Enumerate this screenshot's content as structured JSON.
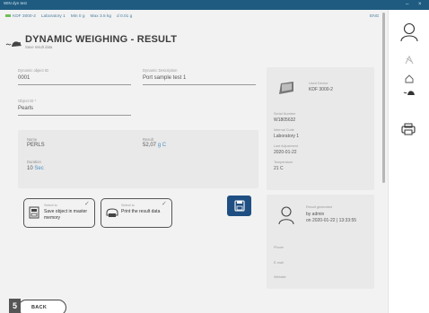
{
  "titlebar": {
    "app": "WIN dyn test",
    "minimize": "–",
    "close": "×"
  },
  "infobar": {
    "device": "KDF 3000-2",
    "lab": "Laboratory 1",
    "min": "Min 0 g",
    "max": "Max 3.5 kg",
    "d": "d 0.01 g",
    "lang": "ENG"
  },
  "header": {
    "title": "DYNAMIC WEIGHING - RESULT",
    "subtitle": "Save result data"
  },
  "form": {
    "dyn_object_label": "Dynamic object ID",
    "dyn_object_value": "0001",
    "dyn_desc_label": "Dynamic Description",
    "dyn_desc_value": "Port sample test 1",
    "object_label": "Object ID *",
    "object_value": "Pearls"
  },
  "result": {
    "name_label": "Name",
    "name_value": "PERLS",
    "result_label": "Result",
    "result_value": "52,07",
    "result_unit": "g C",
    "duration_label": "Duration",
    "duration_value": "10",
    "duration_unit": "Sec"
  },
  "options": [
    {
      "select": "Select to",
      "text": "Save object in master memory"
    },
    {
      "select": "Select to",
      "text": "Print the result data"
    }
  ],
  "device": {
    "used_label": "Used Device",
    "used_value": "KDF 3000-2",
    "serial_label": "Serial Number",
    "serial_value": "W1805632",
    "internal_label": "Internal Code",
    "internal_value": "Laboratory 1",
    "adj_label": "Last Adjustment",
    "adj_value": "2020-01-22",
    "temp_label": "Temperature",
    "temp_value": "21 C"
  },
  "report": {
    "gen_label": "Result generated",
    "gen_by": "by admin",
    "gen_on": "on 2020-01-22 | 13:33:55",
    "phone_label": "Phone",
    "email_label": "E-mail",
    "website_label": "Website"
  },
  "footer": {
    "back_label": "BACK",
    "badge": "5"
  },
  "colors": {
    "titlebar": "#1f5b80",
    "accent": "#1f4f82",
    "link": "#4a7fa1"
  }
}
